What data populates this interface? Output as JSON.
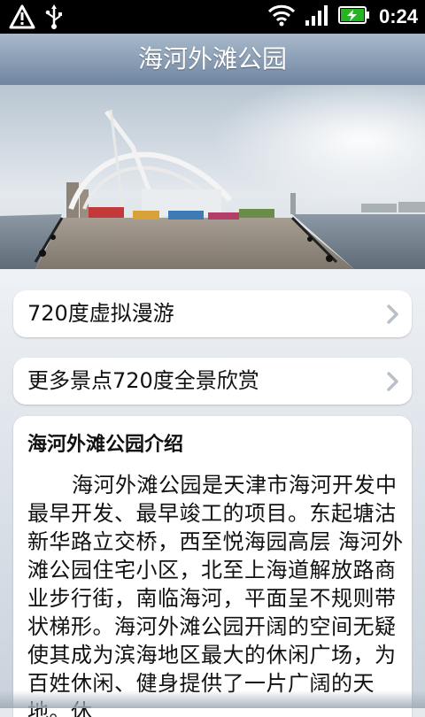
{
  "status_bar": {
    "time": "0:24",
    "icons": [
      "warning-icon",
      "usb-icon",
      "wifi-icon",
      "signal-icon",
      "battery-charging-icon"
    ]
  },
  "title": "海河外滩公园",
  "menu": [
    {
      "label": "720度虚拟漫游",
      "icon": "chevron-right-icon"
    },
    {
      "label": "更多景点720度全景欣赏",
      "icon": "chevron-right-icon"
    }
  ],
  "intro": {
    "heading": "海河外滩公园介绍",
    "body": "海河外滩公园是天津市海河开发中最早开发、最早竣工的项目。东起塘沽新华路立交桥，西至悦海园高层 海河外滩公园住宅小区，北至上海道解放路商业步行街，南临海河，平面呈不规则带状梯形。海河外滩公园开阔的空间无疑使其成为滨海地区最大的休闲广场，为百姓休闲、健身提供了一片广阔的天地。休"
  },
  "colors": {
    "titlebar_top": "#a9b9cb",
    "titlebar_bottom": "#6f85a0",
    "content_bg": "#e6eaef"
  }
}
